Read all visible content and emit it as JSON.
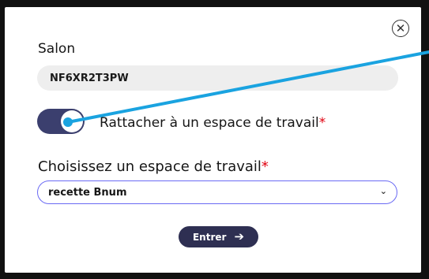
{
  "dialog": {
    "close_icon": "close-circle-icon",
    "salon": {
      "label": "Salon",
      "value": "NF6XR2T3PW"
    },
    "attach_toggle": {
      "label": "Rattacher à un espace de travail",
      "required_mark": "*",
      "checked": true
    },
    "workspace": {
      "label": "Choisissez un espace de travail",
      "required_mark": "*",
      "selected": "recette Bnum"
    },
    "enter_button": {
      "label": "Entrer",
      "icon": "arrow-right-icon"
    }
  },
  "colors": {
    "toggle_on": "#3b3f6e",
    "button": "#2e2f52",
    "select_border": "#6a6af4",
    "required": "#e1000f",
    "annotation_line": "#1aa3e0"
  }
}
